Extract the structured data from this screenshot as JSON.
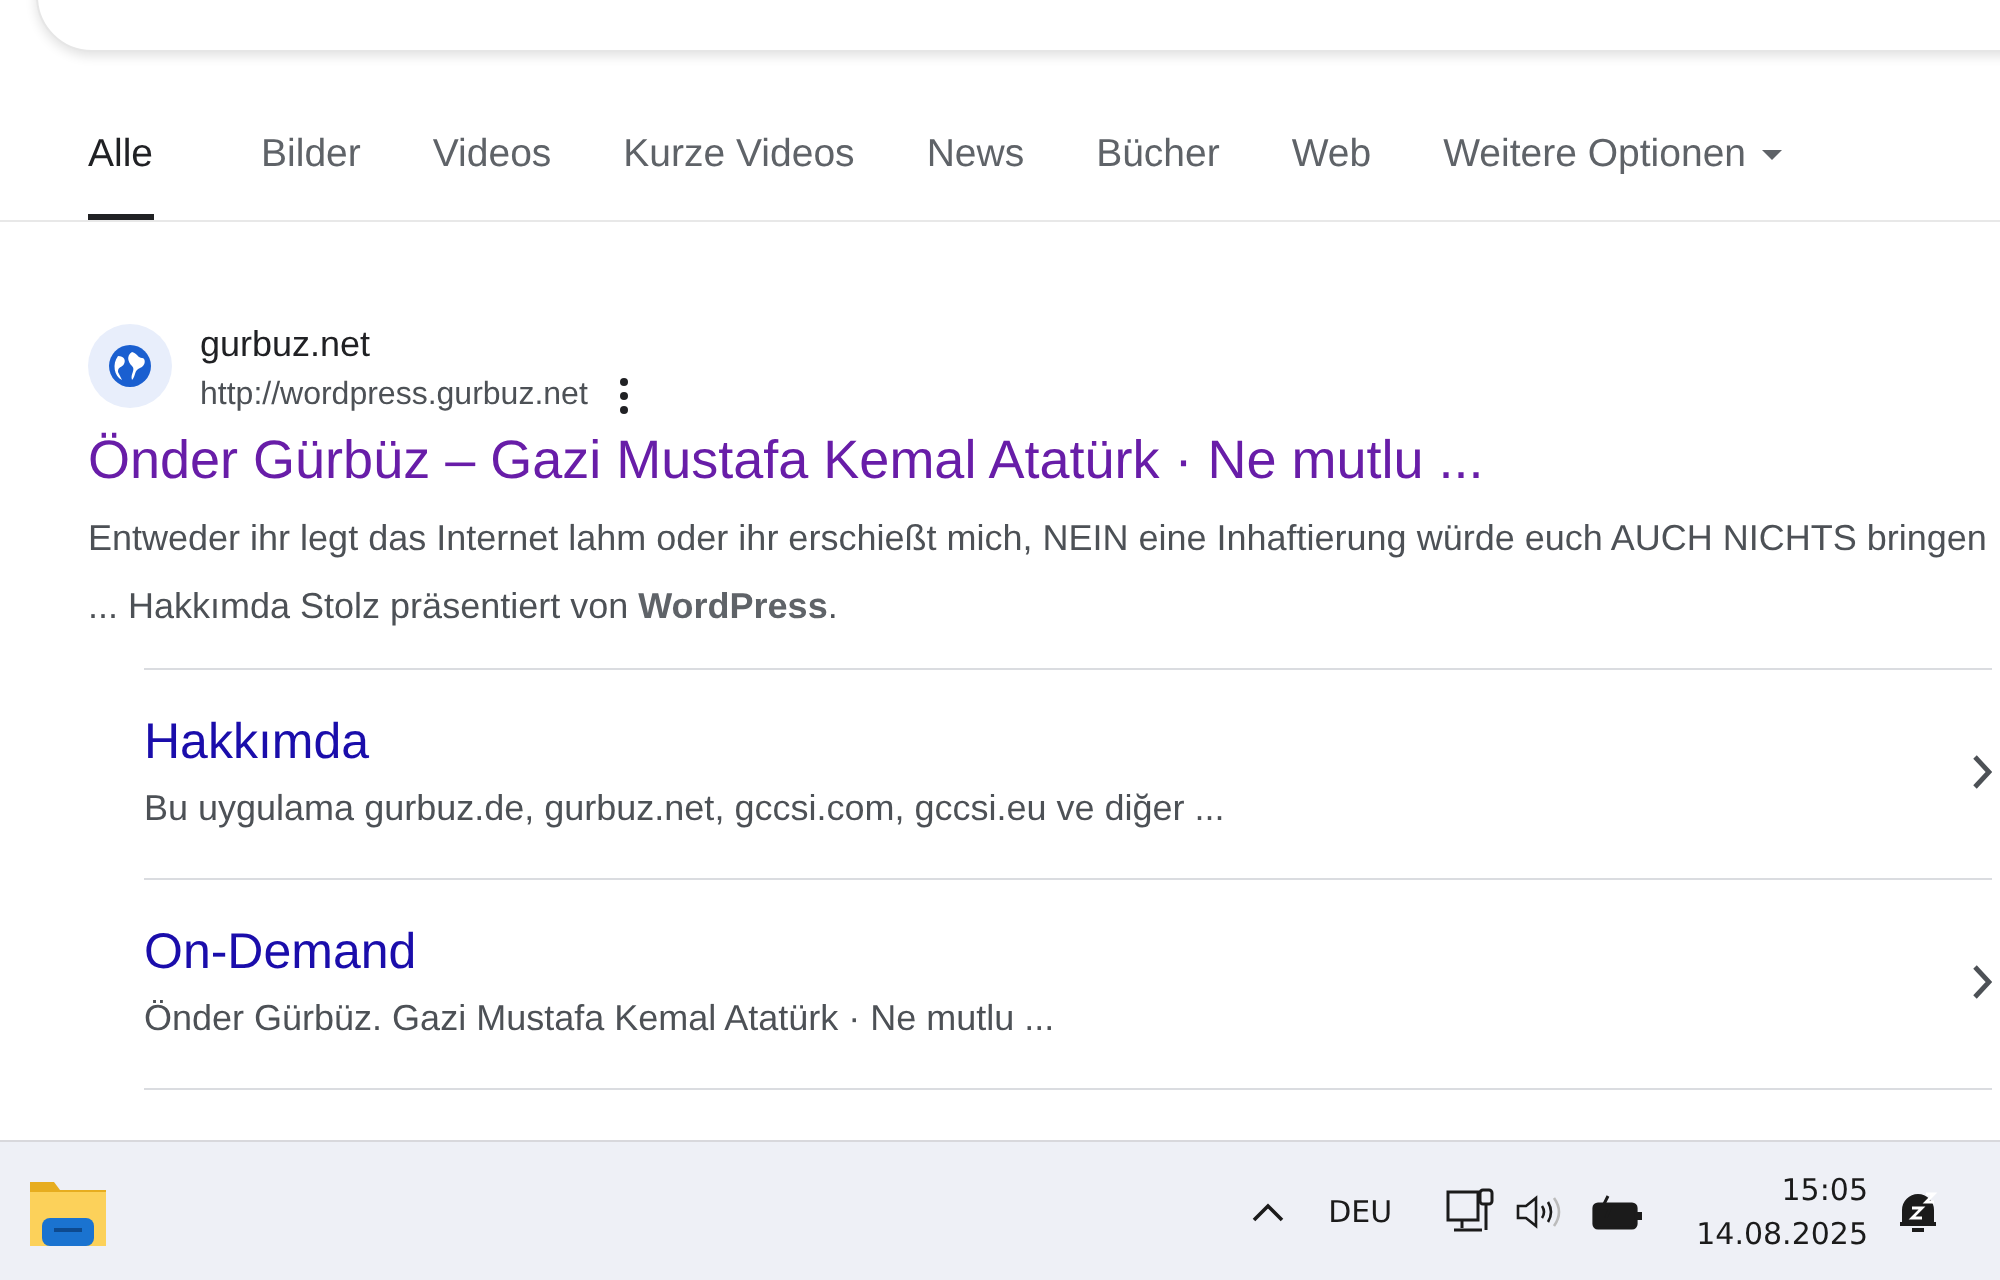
{
  "tabs": [
    {
      "label": "Alle",
      "selected": true,
      "kind": "tab"
    },
    {
      "label": "Bilder",
      "selected": false,
      "kind": "tab"
    },
    {
      "label": "Videos",
      "selected": false,
      "kind": "tab"
    },
    {
      "label": "Kurze Videos",
      "selected": false,
      "kind": "tab"
    },
    {
      "label": "News",
      "selected": false,
      "kind": "tab"
    },
    {
      "label": "Bücher",
      "selected": false,
      "kind": "tab"
    },
    {
      "label": "Web",
      "selected": false,
      "kind": "tab"
    },
    {
      "label": "Weitere Optionen",
      "selected": false,
      "kind": "menu"
    }
  ],
  "result": {
    "site_name": "gurbuz.net",
    "url": "http://wordpress.gurbuz.net",
    "title": "Önder Gürbüz – Gazi Mustafa Kemal Atatürk · Ne mutlu ...",
    "snippet": "Entweder ihr legt das Internet lahm oder ihr erschießt mich, NEIN eine Inhaftierung würde euch AUCH NICHTS bringen ... Hakkımda Stolz präsentiert von **WordPress**.",
    "sitelinks": [
      {
        "title": "Hakkımda",
        "snippet": "Bu uygulama gurbuz.de, gurbuz.net, gccsi.com, gccsi.eu ve diğer ..."
      },
      {
        "title": "On-Demand",
        "snippet": "Önder Gürbüz. Gazi Mustafa Kemal Atatürk · Ne mutlu ..."
      }
    ]
  },
  "taskbar": {
    "language": "DEU",
    "time": "15:05",
    "date": "14.08.2025"
  }
}
